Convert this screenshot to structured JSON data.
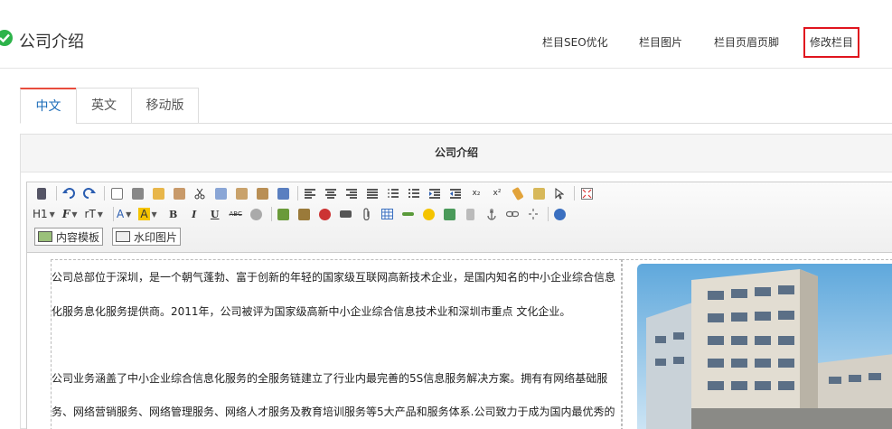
{
  "header": {
    "title": "公司介绍",
    "nav": [
      "栏目SEO优化",
      "栏目图片",
      "栏目页眉页脚",
      "修改栏目"
    ]
  },
  "tabs": [
    "中文",
    "英文",
    "移动版"
  ],
  "panel": {
    "title": "公司介绍"
  },
  "toolbar": {
    "heading_label": "H1",
    "font_label": "F",
    "size_label": "rT",
    "superscript_label": "x²",
    "subscript_label": "x₂",
    "bold_label": "B",
    "italic_label": "I",
    "underline_label": "U",
    "strike_label": "ABC",
    "template_button": "内容模板",
    "watermark_button": "水印图片"
  },
  "content": {
    "paragraphs": [
      "公司总部位于深圳，是一个朝气蓬勃、富于创新的年轻的国家级互联网高新技术企业，是国内知名的中小企业综合信息",
      "化服务息化服务提供商。2011年，公司被评为国家级高新中小企业综合信息技术业和深圳市重点 文化企业。",
      "公司业务涵盖了中小企业综合信息化服务的全服务链建立了行业内最完善的5S信息服务解决方案。拥有有网络基础服",
      "务、网络营销服务、网络管理服务、网络人才服务及教育培训服务等5大产品和服务体系.公司致力于成为国内最优秀的"
    ]
  },
  "colors": {
    "accent_active_tab": "#1a6bb8",
    "highlight_border": "#e0141e",
    "success": "#2db34a"
  }
}
